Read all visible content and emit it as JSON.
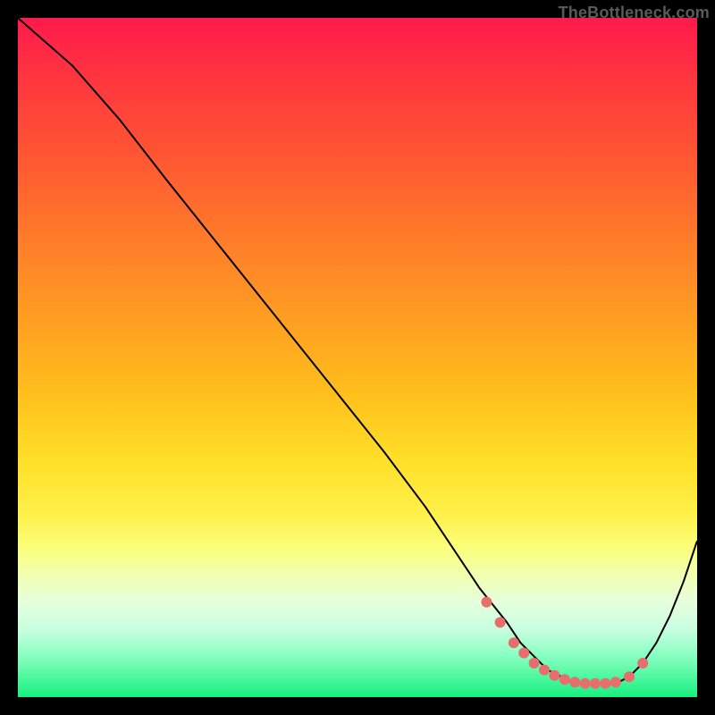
{
  "watermark": "TheBottleneck.com",
  "colors": {
    "curve_stroke": "#000000",
    "marker_fill": "#e86d6d"
  },
  "chart_data": {
    "type": "line",
    "title": "",
    "xlabel": "",
    "ylabel": "",
    "xlim": [
      0,
      100
    ],
    "ylim": [
      0,
      100
    ],
    "series": [
      {
        "name": "curve",
        "x": [
          0,
          8,
          15,
          22,
          30,
          38,
          46,
          54,
          60,
          64,
          68,
          72,
          74,
          76,
          78,
          80,
          82,
          84,
          86,
          88,
          90,
          92,
          94,
          96,
          98,
          100
        ],
        "y": [
          100,
          93,
          85,
          76,
          66,
          56,
          46,
          36,
          28,
          22,
          16,
          11,
          8,
          6,
          4,
          3,
          2,
          2,
          2,
          2,
          3,
          5,
          8,
          12,
          17,
          23
        ]
      }
    ],
    "markers": {
      "name": "flat-region-dots",
      "x": [
        69,
        71,
        73,
        74.5,
        76,
        77.5,
        79,
        80.5,
        82,
        83.5,
        85,
        86.5,
        88,
        90,
        92
      ],
      "y": [
        14,
        11,
        8,
        6.5,
        5,
        4,
        3.2,
        2.6,
        2.2,
        2.0,
        2.0,
        2.0,
        2.2,
        3.0,
        5.0
      ]
    }
  }
}
